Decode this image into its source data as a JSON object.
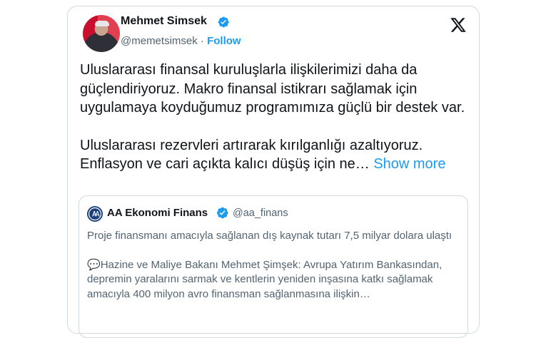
{
  "author": {
    "name": "Mehmet Simsek",
    "handle": "@memetsimsek",
    "separator": "·",
    "follow_label": "Follow",
    "avatar_icon": "profile-photo",
    "verified_icon": "verified-badge-icon"
  },
  "platform": {
    "logo": "x-logo-icon"
  },
  "tweet": {
    "paragraph1": "Uluslararası finansal kuruluşlarla ilişkilerimizi daha da güçlendiriyoruz. Makro finansal istikrarı sağlamak için uygulamaya koyduğumuz programımıza güçlü bir destek var.",
    "paragraph2": "Uluslararası rezervleri artırarak kırılganlığı azaltıyoruz. Enflasyon ve cari açıkta kalıcı düşüş için ne…",
    "show_more_label": "Show more"
  },
  "quoted": {
    "name": "AA Ekonomi Finans",
    "handle": "@aa_finans",
    "paragraph1": "Proje finansmanı amacıyla sağlanan dış kaynak tutarı 7,5 milyar dolara ulaştı",
    "speech_emoji": "💬",
    "paragraph2": "Hazine ve Maliye Bakanı Mehmet Şimşek: Avrupa Yatırım Bankasından, depremin yaralarını sarmak ve kentlerin yeniden inşasına katkı sağlamak amacıyla 400 milyon avro finansman sağlanmasına ilişkin…"
  },
  "colors": {
    "accent": "#1d9bf0",
    "text": "#0f1419",
    "secondary": "#536471",
    "border": "#cfd9de",
    "verified": "#1d9bf0"
  }
}
